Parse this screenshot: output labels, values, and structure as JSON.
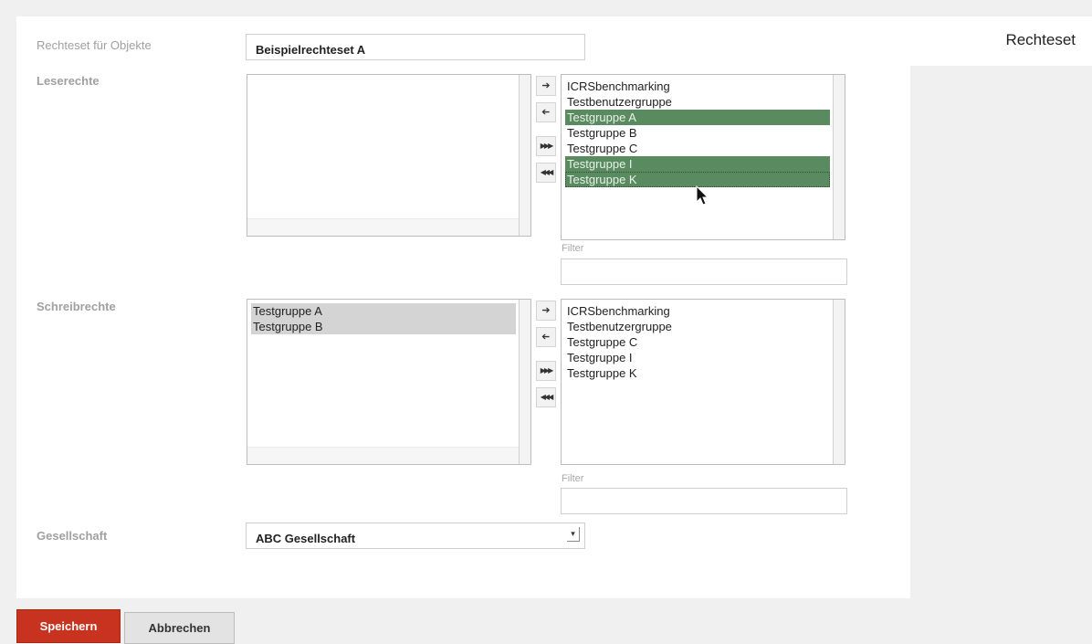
{
  "tab": {
    "title": "Rechteset"
  },
  "form": {
    "name_label": "Rechteset für Objekte",
    "name_value": "Beispielrechteset A",
    "read_label": "Leserechte",
    "write_label": "Schreibrechte",
    "company_label": "Gesellschaft",
    "company_value": "ABC Gesellschaft",
    "filter_label": "Filter"
  },
  "read": {
    "selected": [],
    "available": [
      {
        "label": "ICRSbenchmarking",
        "highlighted": false
      },
      {
        "label": "Testbenutzergruppe",
        "highlighted": false
      },
      {
        "label": "Testgruppe A",
        "highlighted": true
      },
      {
        "label": "Testgruppe B",
        "highlighted": false
      },
      {
        "label": "Testgruppe C",
        "highlighted": false
      },
      {
        "label": "Testgruppe I",
        "highlighted": true
      },
      {
        "label": "Testgruppe K",
        "highlighted": true
      }
    ]
  },
  "write": {
    "selected": [
      {
        "label": "Testgruppe A",
        "highlighted": true
      },
      {
        "label": "Testgruppe B",
        "highlighted": true
      }
    ],
    "available": [
      {
        "label": "ICRSbenchmarking",
        "highlighted": false
      },
      {
        "label": "Testbenutzergruppe",
        "highlighted": false
      },
      {
        "label": "Testgruppe C",
        "highlighted": false
      },
      {
        "label": "Testgruppe I",
        "highlighted": false
      },
      {
        "label": "Testgruppe K",
        "highlighted": false
      }
    ]
  },
  "transfer_buttons": {
    "add": "➔",
    "remove": "➔",
    "add_all": "⏵⏵⏵",
    "remove_all": "⏴⏴⏴"
  },
  "actions": {
    "save": "Speichern",
    "cancel": "Abbrechen"
  },
  "colors": {
    "selection_green": "#5a8a60",
    "save_red": "#c7331e"
  }
}
